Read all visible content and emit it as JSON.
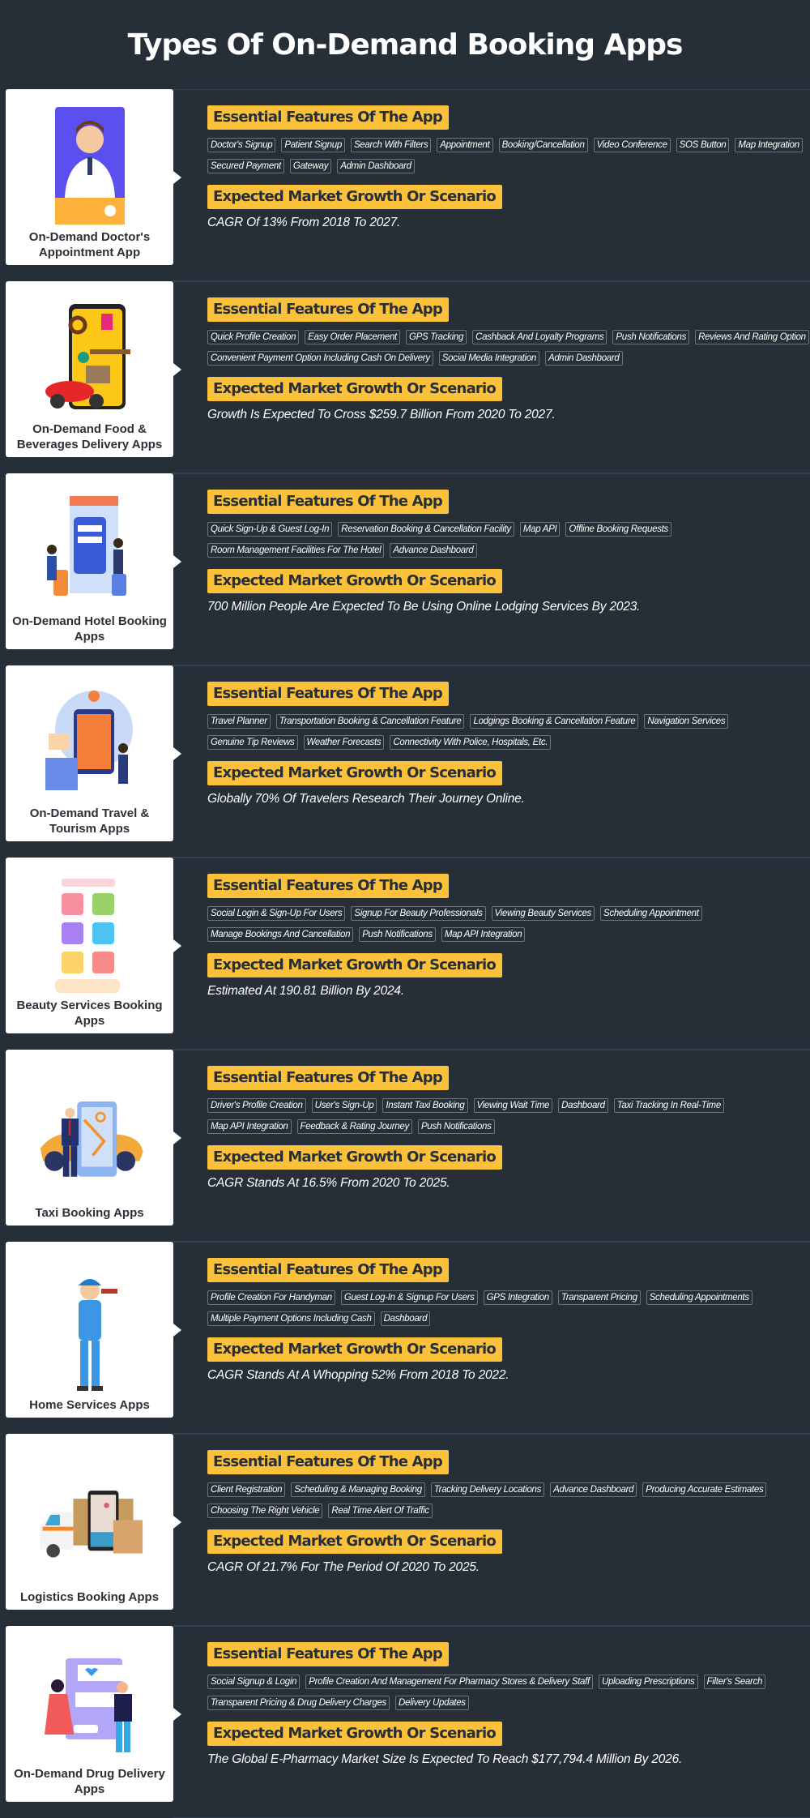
{
  "page": {
    "title": "Types Of On-Demand Booking Apps",
    "features_heading": "Essential Features Of The App",
    "growth_heading": "Expected Market Growth Or Scenario",
    "colors": {
      "background": "#262e37",
      "accent": "#fcc13a",
      "card": "#ffffff"
    }
  },
  "apps": [
    {
      "name": "On-Demand Doctor's Appointment App",
      "icon": "doctor-illustration",
      "features": [
        "Doctor's Signup",
        "Patient Signup",
        "Search With Filters",
        "Appointment",
        "Booking/Cancellation",
        "Video Conference",
        "SOS Button",
        "Map Integration",
        "Secured Payment",
        "Gateway",
        "Admin Dashboard"
      ],
      "growth": "CAGR Of 13% From 2018 To 2027."
    },
    {
      "name": "On-Demand Food & Beverages Delivery Apps",
      "icon": "food-delivery-illustration",
      "features": [
        "Quick Profile Creation",
        "Easy Order Placement",
        "GPS Tracking",
        "Cashback And Loyalty Programs",
        "Push Notifications",
        "Reviews And Rating Option",
        "Convenient Payment Option Including Cash On Delivery",
        "Social Media Integration",
        "Admin Dashboard"
      ],
      "growth": "Growth Is Expected To Cross $259.7 Billion From 2020 To 2027."
    },
    {
      "name": "On-Demand Hotel Booking Apps",
      "icon": "hotel-illustration",
      "features": [
        "Quick Sign-Up & Guest Log-In",
        "Reservation Booking & Cancellation Facility",
        "Map API",
        "Offline Booking Requests",
        "Room Management Facilities For The Hotel",
        "Advance Dashboard"
      ],
      "growth": "700 Million People Are Expected To Be Using Online Lodging Services By 2023."
    },
    {
      "name": "On-Demand Travel & Tourism Apps",
      "icon": "travel-illustration",
      "features": [
        "Travel Planner",
        "Transportation Booking & Cancellation Feature",
        "Lodgings Booking & Cancellation Feature",
        "Navigation Services",
        "Genuine Tip Reviews",
        "Weather Forecasts",
        "Connectivity With Police, Hospitals, Etc."
      ],
      "growth": "Globally 70% Of Travelers Research Their Journey Online."
    },
    {
      "name": "Beauty Services Booking Apps",
      "icon": "beauty-illustration",
      "features": [
        "Social Login & Sign-Up For Users",
        "Signup For Beauty Professionals",
        "Viewing Beauty Services",
        "Scheduling Appointment",
        "Manage Bookings And Cancellation",
        "Push Notifications",
        "Map API Integration"
      ],
      "growth": "Estimated At 190.81 Billion By 2024."
    },
    {
      "name": "Taxi Booking Apps",
      "icon": "taxi-illustration",
      "features": [
        "Driver's Profile Creation",
        "User's Sign-Up",
        "Instant Taxi Booking",
        "Viewing Wait Time",
        "Dashboard",
        "Taxi Tracking In Real-Time",
        "Map API Integration",
        "Feedback & Rating Journey",
        "Push Notifications"
      ],
      "growth": "CAGR Stands At 16.5% From 2020 To 2025."
    },
    {
      "name": "Home Services Apps",
      "icon": "handyman-illustration",
      "features": [
        "Profile Creation For Handyman",
        "Guest Log-In & Signup For Users",
        "GPS Integration",
        "Transparent Pricing",
        "Scheduling Appointments",
        "Multiple Payment Options Including Cash",
        "Dashboard"
      ],
      "growth": "CAGR Stands At A Whopping 52% From 2018 To 2022."
    },
    {
      "name": "Logistics Booking Apps",
      "icon": "logistics-illustration",
      "features": [
        "Client Registration",
        "Scheduling & Managing Booking",
        "Tracking Delivery Locations",
        "Advance Dashboard",
        "Producing Accurate Estimates",
        "Choosing The Right Vehicle",
        "Real Time Alert Of Traffic"
      ],
      "growth": "CAGR Of 21.7% For The Period Of 2020 To 2025."
    },
    {
      "name": "On-Demand Drug Delivery Apps",
      "icon": "pharmacy-illustration",
      "features": [
        "Social Signup & Login",
        "Profile Creation And Management For Pharmacy Stores & Delivery Staff",
        "Uploading Prescriptions",
        "Filter's Search",
        "Transparent Pricing & Drug Delivery Charges",
        "Delivery Updates"
      ],
      "growth": "The Global E-Pharmacy Market Size Is Expected To Reach $177,794.4 Million By 2026."
    }
  ]
}
